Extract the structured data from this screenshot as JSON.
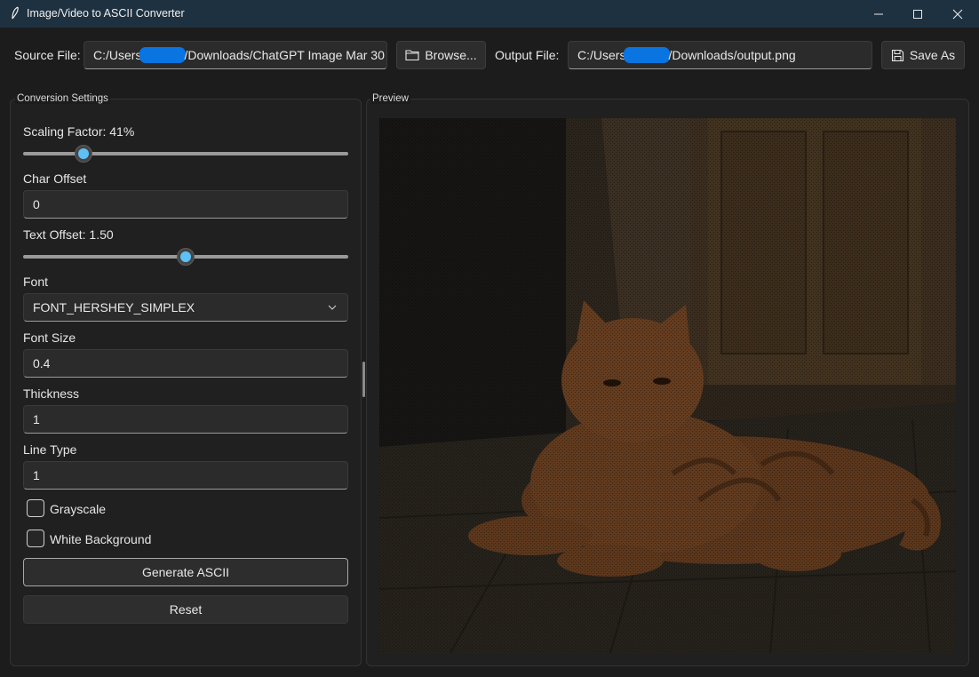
{
  "window": {
    "title": "Image/Video to ASCII Converter"
  },
  "topbar": {
    "source_label": "Source File:",
    "source_prefix": "C:/Users",
    "source_suffix": "/Downloads/ChatGPT Image Mar 30",
    "browse_label": "Browse...",
    "output_label": "Output File:",
    "output_prefix": "C:/Users",
    "output_suffix": "/Downloads/output.png",
    "save_label": "Save As"
  },
  "settings": {
    "group_title": "Conversion Settings",
    "scaling_label": "Scaling Factor: 41%",
    "scaling_value": 0.41,
    "char_offset_label": "Char Offset",
    "char_offset_value": "0",
    "text_offset_label": "Text Offset: 1.50",
    "text_offset_value": 0.5,
    "font_label": "Font",
    "font_value": "FONT_HERSHEY_SIMPLEX",
    "font_size_label": "Font Size",
    "font_size_value": "0.4",
    "thickness_label": "Thickness",
    "thickness_value": "1",
    "line_type_label": "Line Type",
    "line_type_value": "1",
    "grayscale_label": "Grayscale",
    "grayscale_checked": false,
    "white_bg_label": "White Background",
    "white_bg_checked": false,
    "generate_label": "Generate ASCII",
    "reset_label": "Reset"
  },
  "preview": {
    "group_title": "Preview"
  },
  "colors": {
    "accent": "#5fc0f5",
    "titlebar": "#1e3140",
    "redaction": "#0a74e0"
  },
  "icons": {
    "app": "feather-icon",
    "browse": "folder-icon",
    "save": "floppy-disk-icon"
  }
}
